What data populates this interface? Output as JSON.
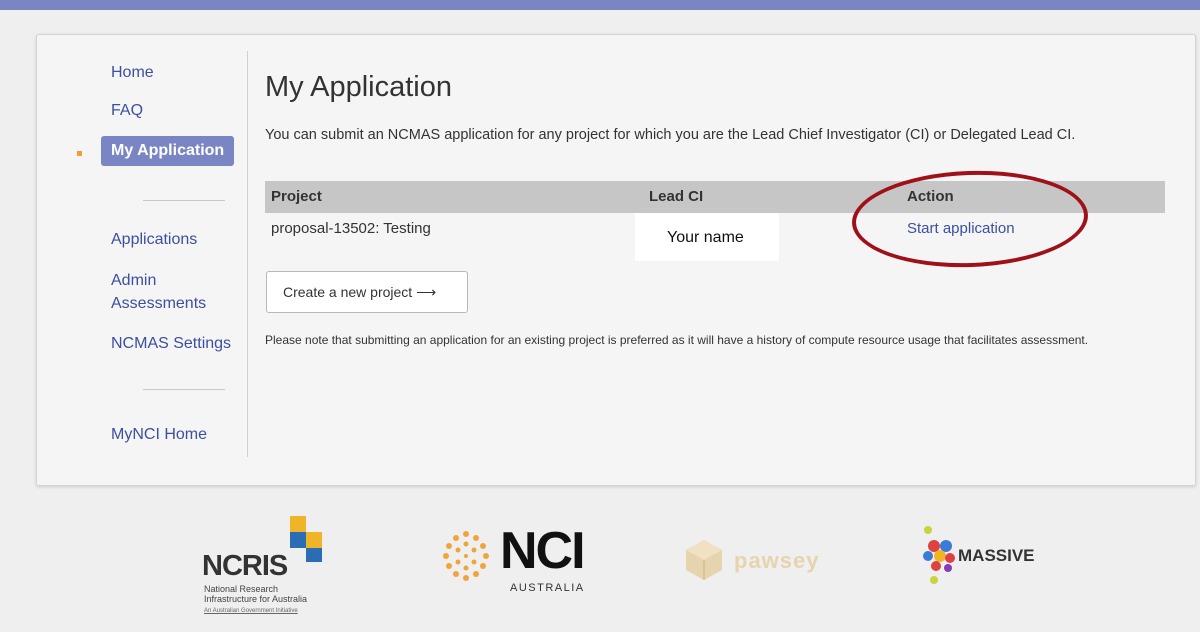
{
  "sidebar": {
    "items": [
      {
        "label": "Home"
      },
      {
        "label": "FAQ"
      },
      {
        "label": "My Application"
      },
      {
        "label": "Applications"
      },
      {
        "label": "Admin Assessments"
      },
      {
        "label": "NCMAS Settings"
      },
      {
        "label": "MyNCI Home"
      }
    ]
  },
  "main": {
    "title": "My Application",
    "intro": "You can submit an NCMAS application for any project for which you are the Lead Chief Investigator (CI) or Delegated Lead CI.",
    "table": {
      "headers": [
        "Project",
        "Lead CI",
        "Action"
      ],
      "rows": [
        {
          "project": "proposal-13502: Testing",
          "lead_ci": "Your name",
          "action": "Start application"
        }
      ]
    },
    "create_button": "Create a new project  ⟶",
    "note": "Please note that submitting an application for an existing project is preferred as it will have a history of compute resource usage that facilitates assessment."
  },
  "footer": {
    "logos": {
      "ncris": {
        "name": "NCRIS",
        "line1": "National Research",
        "line2": "Infrastructure for Australia",
        "line3": "An Australian Government Initiative"
      },
      "nci": {
        "name": "NCI",
        "sub": "AUSTRALIA"
      },
      "pawsey": {
        "name": "pawsey"
      },
      "massive": {
        "name": "MASSIVE"
      }
    }
  },
  "colors": {
    "accent": "#7a86c4",
    "link": "#3c4fa0",
    "annotation": "#a01018"
  }
}
